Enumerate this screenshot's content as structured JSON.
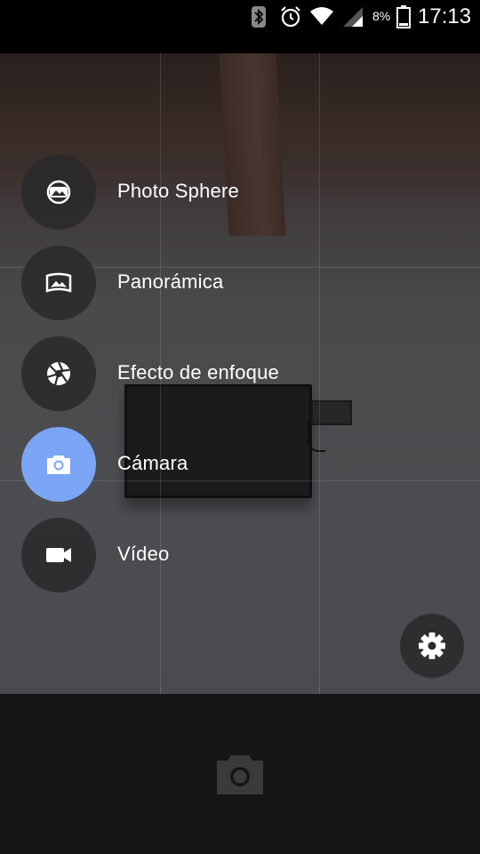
{
  "status_bar": {
    "battery_percent": "8%",
    "time": "17:13",
    "icons": [
      "bluetooth-icon",
      "alarm-icon",
      "wifi-icon",
      "signal-icon",
      "battery-icon"
    ]
  },
  "modes": [
    {
      "label": "Photo Sphere",
      "icon": "photo-sphere-icon",
      "active": false
    },
    {
      "label": "Panorámica",
      "icon": "panorama-icon",
      "active": false
    },
    {
      "label": "Efecto de enfoque",
      "icon": "aperture-icon",
      "active": false
    },
    {
      "label": "Cámara",
      "icon": "camera-icon",
      "active": true
    },
    {
      "label": "Vídeo",
      "icon": "video-icon",
      "active": false
    }
  ],
  "controls": {
    "settings_icon": "gear-icon",
    "shutter_icon": "camera-icon"
  },
  "colors": {
    "accent": "#7ba5f5",
    "overlay": "#28282a",
    "bottom_bar": "#151515"
  }
}
